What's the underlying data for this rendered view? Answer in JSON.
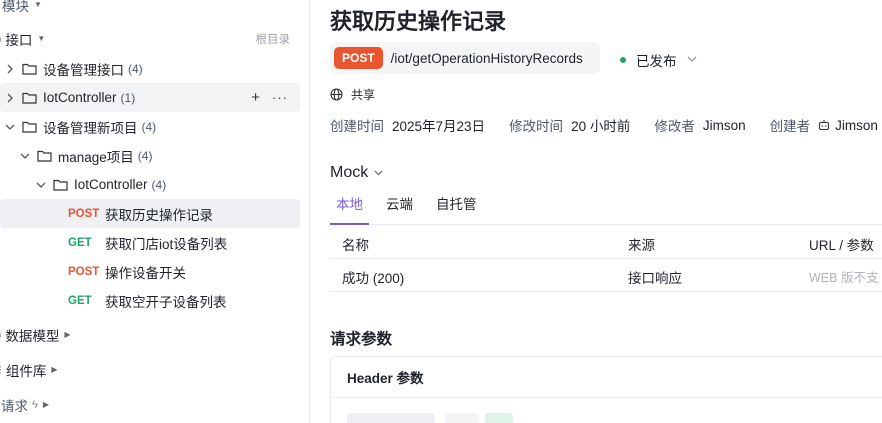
{
  "sidebar": {
    "top_partial": "模块",
    "api_section": {
      "label": "接口",
      "right_text": "根目录"
    },
    "items": [
      {
        "label": "设备管理接口",
        "count": "(4)"
      },
      {
        "label": "IotController",
        "count": "(1)"
      },
      {
        "label": "设备管理新项目",
        "count": "(4)"
      },
      {
        "label": "manage项目",
        "count": "(4)"
      },
      {
        "label": "IotController",
        "count": "(4)"
      }
    ],
    "endpoints": [
      {
        "method": "POST",
        "label": "获取历史操作记录"
      },
      {
        "method": "GET",
        "label": "获取门店iot设备列表"
      },
      {
        "method": "POST",
        "label": "操作设备开关"
      },
      {
        "method": "GET",
        "label": "获取空开子设备列表"
      }
    ],
    "sections": [
      {
        "label": "数据模型"
      },
      {
        "label": "组件库"
      },
      {
        "label": "请求"
      }
    ]
  },
  "main": {
    "title": "获取历史操作记录",
    "method": "POST",
    "path": "/iot/getOperationHistoryRecords",
    "status": "已发布",
    "share": "共享",
    "meta": {
      "created_label": "创建时间",
      "created_value": "2025年7月23日",
      "modified_label": "修改时间",
      "modified_value": "20 小时前",
      "modifier_label": "修改者",
      "modifier_value": "Jimson",
      "creator_label": "创建者",
      "creator_value": "Jimson"
    },
    "mock": {
      "title": "Mock",
      "tabs": [
        "本地",
        "云端",
        "自托管"
      ],
      "columns": [
        "名称",
        "来源",
        "URL / 参数"
      ],
      "rows": [
        {
          "name": "成功 (200)",
          "source": "接口响应",
          "url": "WEB 版不支"
        }
      ]
    },
    "request": {
      "title": "请求参数",
      "header_label": "Header 参数"
    }
  },
  "colors": {
    "post": "#e8552f",
    "get": "#23a36a",
    "accent": "#7b58d6",
    "status": "#23a36a"
  }
}
